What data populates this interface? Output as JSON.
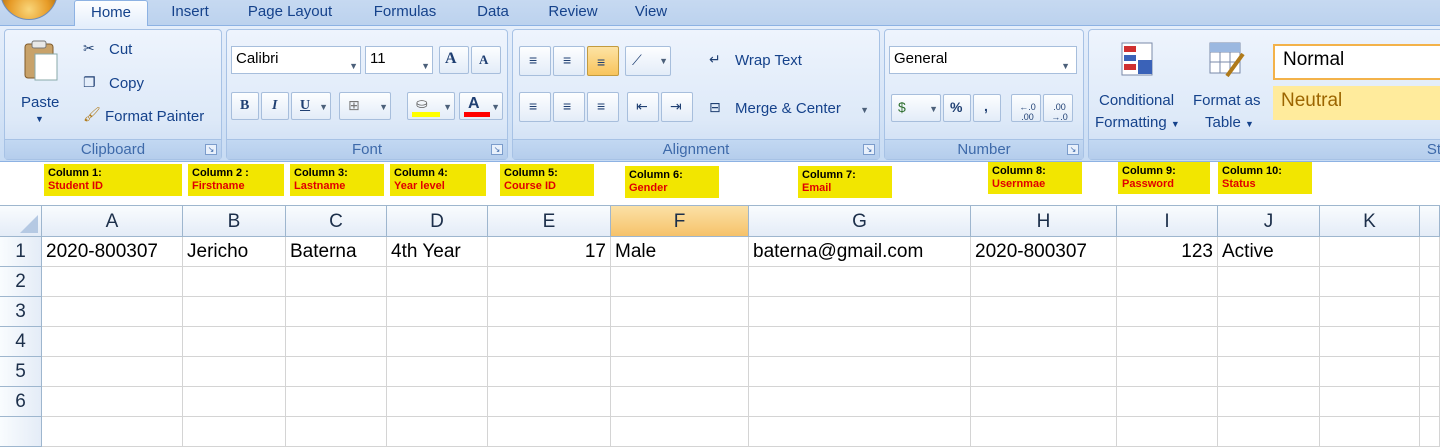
{
  "tabs": [
    "Home",
    "Insert",
    "Page Layout",
    "Formulas",
    "Data",
    "Review",
    "View"
  ],
  "active_tab": "Home",
  "clipboard": {
    "paste_label": "Paste",
    "cut_label": "Cut",
    "copy_label": "Copy",
    "format_painter_label": "Format Painter",
    "group_label": "Clipboard"
  },
  "font": {
    "name": "Calibri",
    "size": "11",
    "bold": "B",
    "italic": "I",
    "underline": "U",
    "grow": "A",
    "shrink": "A",
    "fill_color": "#ffff00",
    "font_color": "#ff0000",
    "group_label": "Font"
  },
  "alignment": {
    "wrap_text_label": "Wrap Text",
    "merge_center_label": "Merge & Center",
    "group_label": "Alignment"
  },
  "number": {
    "format": "General",
    "percent": "%",
    "comma": ",",
    "increase_decimal": "←.0 .00",
    "decrease_decimal": ".00 →.0",
    "group_label": "Number"
  },
  "styles": {
    "conditional_formatting_line1": "Conditional",
    "conditional_formatting_line2": "Formatting",
    "format_as_table_line1": "Format as",
    "format_as_table_line2": "Table",
    "normal_label": "Normal",
    "neutral_label": "Neutral",
    "group_label_partial": "St"
  },
  "annotations": [
    {
      "title": "Column 1:",
      "field": "Student ID"
    },
    {
      "title": "Column 2 :",
      "field": "Firstname"
    },
    {
      "title": "Column 3:",
      "field": "Lastname"
    },
    {
      "title": "Column 4:",
      "field": "Year level"
    },
    {
      "title": "Column 5:",
      "field": "Course ID"
    },
    {
      "title": "Column 6:",
      "field": "Gender"
    },
    {
      "title": "Column 7:",
      "field": "Email"
    },
    {
      "title": "Column 8:",
      "field": "Usernmae"
    },
    {
      "title": "Column 9:",
      "field": "Password"
    },
    {
      "title": "Column 10:",
      "field": "Status"
    }
  ],
  "grid": {
    "columns": [
      "A",
      "B",
      "C",
      "D",
      "E",
      "F",
      "G",
      "H",
      "I",
      "J",
      "K"
    ],
    "selected_column": "F",
    "row_numbers": [
      "1",
      "2",
      "3",
      "4",
      "5",
      "6"
    ],
    "rows": [
      [
        "2020-800307",
        "Jericho",
        "Baterna",
        "4th Year",
        "17",
        "Male",
        "baterna@gmail.com",
        "2020-800307",
        "123",
        "Active",
        ""
      ]
    ]
  }
}
